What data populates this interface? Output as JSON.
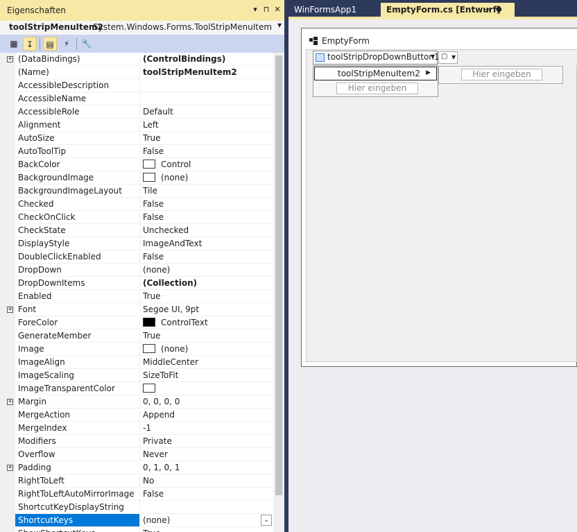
{
  "properties_panel": {
    "title": "Eigenschaften",
    "title_buttons": [
      "▾",
      "⊓",
      "✕"
    ],
    "object_name": "toolStripMenuItem2",
    "object_type": "System.Windows.Forms.ToolStripMenuItem",
    "rows": [
      {
        "name": "(DataBindings)",
        "value": "(ControlBindings)",
        "bold": true,
        "expand": true
      },
      {
        "name": "(Name)",
        "value": "toolStripMenuItem2",
        "bold": true
      },
      {
        "name": "AccessibleDescription",
        "value": ""
      },
      {
        "name": "AccessibleName",
        "value": ""
      },
      {
        "name": "AccessibleRole",
        "value": "Default"
      },
      {
        "name": "Alignment",
        "value": "Left"
      },
      {
        "name": "AutoSize",
        "value": "True"
      },
      {
        "name": "AutoToolTip",
        "value": "False"
      },
      {
        "name": "BackColor",
        "value": "Control",
        "swatch": "#ffffff"
      },
      {
        "name": "BackgroundImage",
        "value": "(none)",
        "swatch": "#ffffff"
      },
      {
        "name": "BackgroundImageLayout",
        "value": "Tile"
      },
      {
        "name": "Checked",
        "value": "False"
      },
      {
        "name": "CheckOnClick",
        "value": "False"
      },
      {
        "name": "CheckState",
        "value": "Unchecked"
      },
      {
        "name": "DisplayStyle",
        "value": "ImageAndText"
      },
      {
        "name": "DoubleClickEnabled",
        "value": "False"
      },
      {
        "name": "DropDown",
        "value": "(none)"
      },
      {
        "name": "DropDownItems",
        "value": "(Collection)",
        "bold": true
      },
      {
        "name": "Enabled",
        "value": "True"
      },
      {
        "name": "Font",
        "value": "Segoe UI, 9pt",
        "expand": true
      },
      {
        "name": "ForeColor",
        "value": "ControlText",
        "swatch": "#000000"
      },
      {
        "name": "GenerateMember",
        "value": "True"
      },
      {
        "name": "Image",
        "value": "(none)",
        "swatch": "#ffffff"
      },
      {
        "name": "ImageAlign",
        "value": "MiddleCenter"
      },
      {
        "name": "ImageScaling",
        "value": "SizeToFit"
      },
      {
        "name": "ImageTransparentColor",
        "value": "",
        "swatch": "#ffffff"
      },
      {
        "name": "Margin",
        "value": "0, 0, 0, 0",
        "expand": true
      },
      {
        "name": "MergeAction",
        "value": "Append"
      },
      {
        "name": "MergeIndex",
        "value": "-1"
      },
      {
        "name": "Modifiers",
        "value": "Private"
      },
      {
        "name": "Overflow",
        "value": "Never"
      },
      {
        "name": "Padding",
        "value": "0, 1, 0, 1",
        "expand": true
      },
      {
        "name": "RightToLeft",
        "value": "No"
      },
      {
        "name": "RightToLeftAutoMirrorImage",
        "value": "False"
      },
      {
        "name": "ShortcutKeyDisplayString",
        "value": ""
      },
      {
        "name": "ShortcutKeys",
        "value": "(none)",
        "selected": true,
        "dropdown": true
      },
      {
        "name": "ShowShortcutKeys",
        "value": "True"
      }
    ]
  },
  "tabs": [
    {
      "label": "WinFormsApp1"
    },
    {
      "label": "EmptyForm.cs [Entwurf]",
      "pin": "⊸",
      "dot": "●"
    }
  ],
  "designer": {
    "form_title": "EmptyForm",
    "dropdown_button": "toolStripDropDownButton1",
    "menu_item": "toolStripMenuItem2",
    "placeholder_1": "Hier eingeben",
    "placeholder_2": "Hier eingeben"
  },
  "colors": {
    "accent": "#f7e8a6",
    "selection": "#0078d7",
    "chrome": "#2d3a5c"
  }
}
